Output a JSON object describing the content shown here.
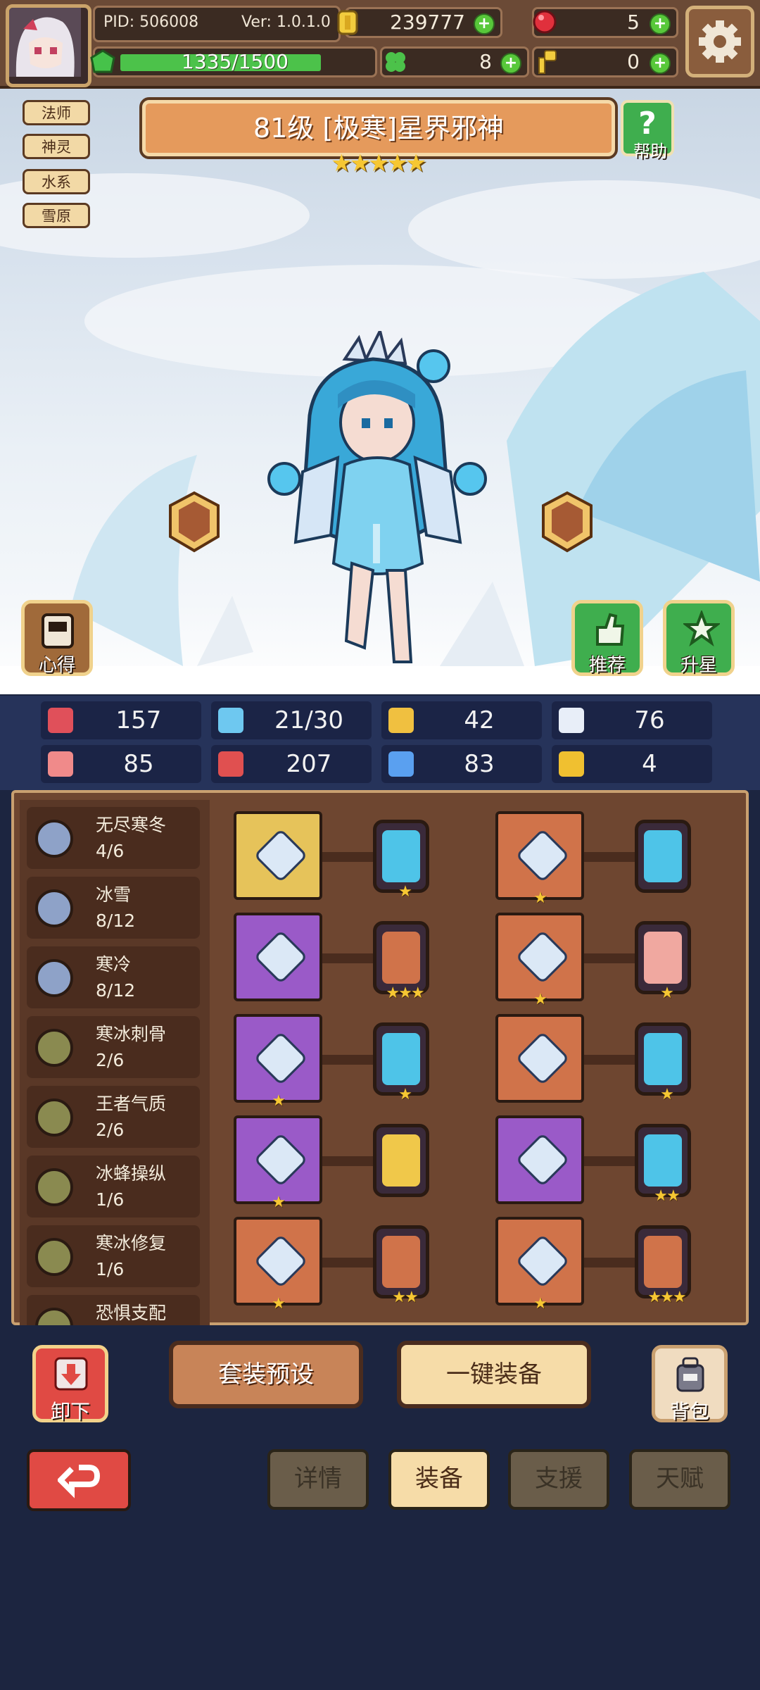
{
  "topbar": {
    "pid": "PID: 506008",
    "version": "Ver: 1.0.1.0",
    "gold": "239777",
    "gems": "5",
    "energy": "1335/1500",
    "energy_fraction": 0.89,
    "clover": "8",
    "key": "0"
  },
  "tags": [
    "法师",
    "神灵",
    "水系",
    "雪原"
  ],
  "hero": {
    "title": "81级 [极寒]星界邪神",
    "star_count": 5,
    "help_label": "帮助",
    "insight_label": "心得",
    "recommend_label": "推荐",
    "upstar_label": "升星"
  },
  "stats": [
    {
      "icon": "heart-icon",
      "value": "157",
      "color": "#e0505a"
    },
    {
      "icon": "mana-drop-icon",
      "value": "21/30",
      "color": "#6ec8f0"
    },
    {
      "icon": "shield-icon",
      "value": "42",
      "color": "#f0c040"
    },
    {
      "icon": "wing-icon",
      "value": "76",
      "color": "#e8eef8"
    },
    {
      "icon": "fist-icon",
      "value": "85",
      "color": "#f08a8a"
    },
    {
      "icon": "book-icon",
      "value": "207",
      "color": "#e05050"
    },
    {
      "icon": "boot-icon",
      "value": "83",
      "color": "#5aa0f0"
    },
    {
      "icon": "horseshoe-icon",
      "value": "4",
      "color": "#f0c030"
    }
  ],
  "sets": [
    {
      "name": "无尽寒冬",
      "count": "4/6",
      "color": "#8ea2c8"
    },
    {
      "name": "冰雪",
      "count": "8/12",
      "color": "#8ea2c8"
    },
    {
      "name": "寒冷",
      "count": "8/12",
      "color": "#8ea2c8"
    },
    {
      "name": "寒冰刺骨",
      "count": "2/6",
      "color": "#8a8a50"
    },
    {
      "name": "王者气质",
      "count": "2/6",
      "color": "#8a8a50"
    },
    {
      "name": "冰蜂操纵",
      "count": "1/6",
      "color": "#8a8a50"
    },
    {
      "name": "寒冰修复",
      "count": "1/6",
      "color": "#8a8a50"
    },
    {
      "name": "恐惧支配",
      "count": "",
      "color": "#8a8a50"
    }
  ],
  "equipment": {
    "left": [
      {
        "icon": "wand-icon",
        "bg": "#e6c35a",
        "stars": "",
        "card": "#4ec4e8",
        "card_stars": "★",
        "rune": "rune-blue-icon"
      },
      {
        "icon": "ice-crown-icon",
        "bg": "#9a5ac8",
        "stars": "",
        "card": "#d0734a",
        "card_stars": "★★★",
        "rune": "rune-orange-icon"
      },
      {
        "icon": "necklace-icon",
        "bg": "#9a5ac8",
        "stars": "★",
        "card": "#4ec4e8",
        "card_stars": "★",
        "rune": "rune-blue-icon"
      },
      {
        "icon": "amulet-icon",
        "bg": "#9a5ac8",
        "stars": "★",
        "card": "#f0c84a",
        "card_stars": "",
        "rune": "rune-yellow-icon"
      },
      {
        "icon": "helmet-icon",
        "bg": "#d0734a",
        "stars": "★",
        "card": "#d0734a",
        "card_stars": "★★",
        "rune": "rune-orange-icon"
      }
    ],
    "right": [
      {
        "icon": "crystal-icon",
        "bg": "#d0734a",
        "stars": "★",
        "card": "#4ec4e8",
        "card_stars": "",
        "rune": "rune-blue-icon"
      },
      {
        "icon": "cape-icon",
        "bg": "#d0734a",
        "stars": "★",
        "card": "#f0a8a0",
        "card_stars": "★",
        "rune": "rune-pink-icon"
      },
      {
        "icon": "glove-icon",
        "bg": "#d0734a",
        "stars": "",
        "card": "#4ec4e8",
        "card_stars": "★",
        "rune": "rune-blue-icon"
      },
      {
        "icon": "armor-icon",
        "bg": "#9a5ac8",
        "stars": "",
        "card": "#4ec4e8",
        "card_stars": "★★",
        "rune": "rune-blue-icon"
      },
      {
        "icon": "boots-icon",
        "bg": "#d0734a",
        "stars": "★",
        "card": "#d0734a",
        "card_stars": "★★★",
        "rune": "rune-orange-icon"
      }
    ]
  },
  "actions": {
    "unequip_label": "卸下",
    "preset_label": "套装预设",
    "auto_equip_label": "一键装备",
    "bag_label": "背包"
  },
  "tabs": [
    "详情",
    "装备",
    "支援",
    "天赋"
  ],
  "active_tab": "装备"
}
